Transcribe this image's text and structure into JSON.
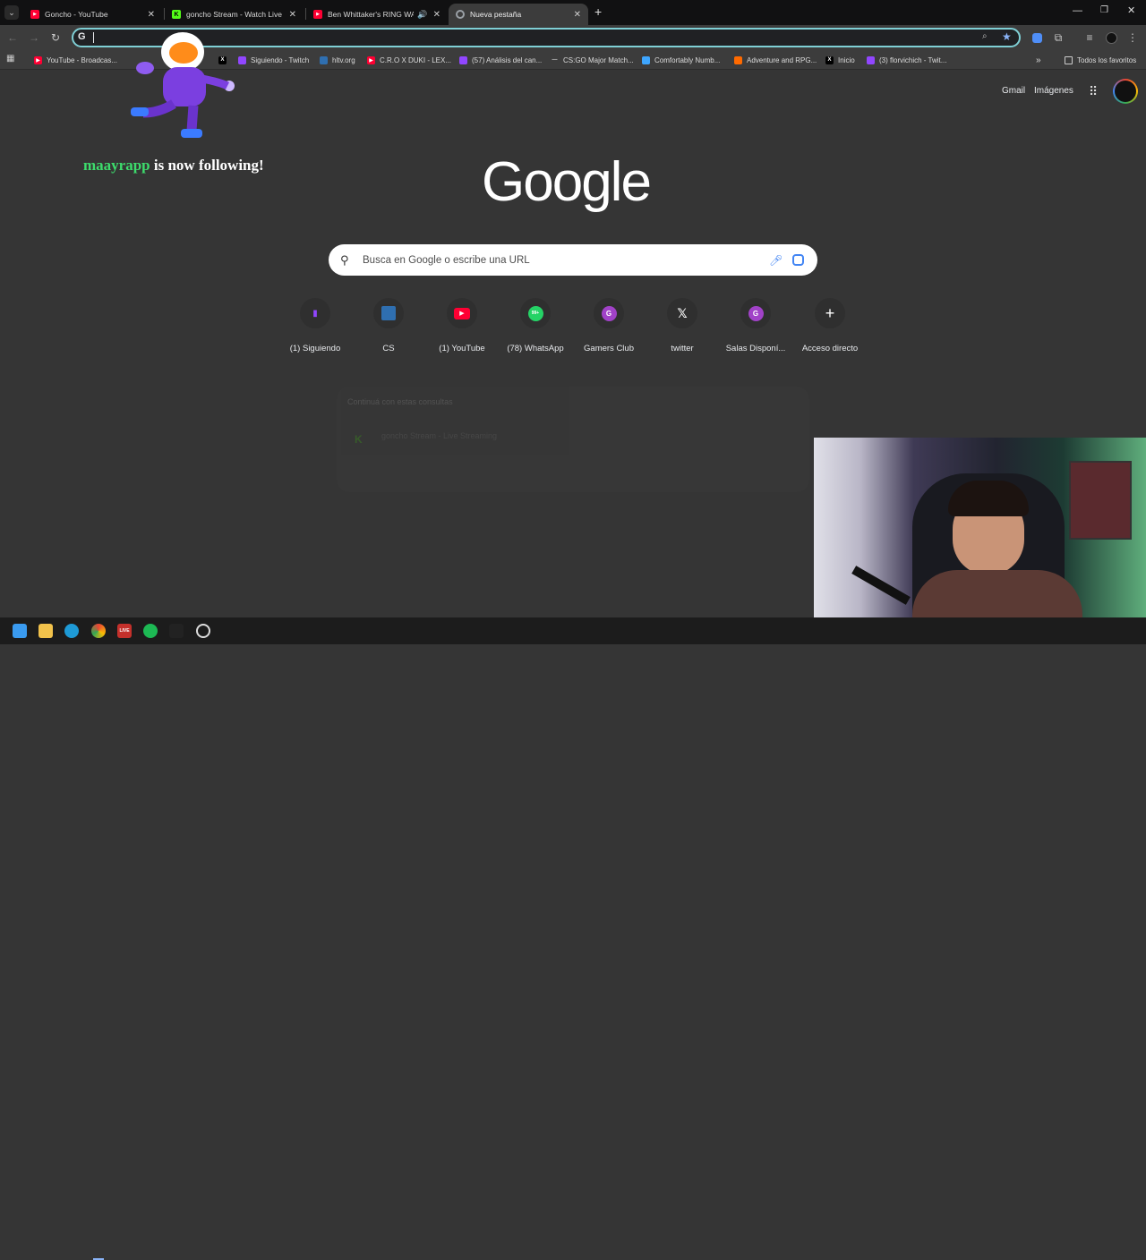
{
  "tabs": [
    {
      "title": "Goncho - YouTube",
      "favicon": "youtube-icon",
      "color": "#ff0033"
    },
    {
      "title": "goncho Stream - Watch Live on",
      "favicon": "kick-icon",
      "color": "#53fc18"
    },
    {
      "title": "Ben Whittaker's RING WALK",
      "favicon": "youtube-icon",
      "color": "#ff0033"
    },
    {
      "title": "Nueva pestaña",
      "favicon": "chrome-icon",
      "color": "#9aa0a6",
      "active": true
    }
  ],
  "omnibox": {
    "value": "",
    "placeholder": ""
  },
  "bookmarks": [
    {
      "label": "YouTube - Broadcas...",
      "icon": "youtube-icon",
      "color": "#ff0033"
    },
    {
      "label": "Siguiendo - Twitch",
      "icon": "twitch-icon",
      "color": "#9146ff"
    },
    {
      "label": "hltv.org",
      "icon": "hltv-icon",
      "color": "#2f6fb0"
    },
    {
      "label": "C.R.O X DUKI - LEX...",
      "icon": "youtube-icon",
      "color": "#ff0033"
    },
    {
      "label": "(57) Análisis del can...",
      "icon": "twitch-icon",
      "color": "#9146ff"
    },
    {
      "label": "CS:GO Major Match...",
      "icon": "hltv-icon",
      "color": "#cccccc"
    },
    {
      "label": "Comfortably Numb...",
      "icon": "doc-icon",
      "color": "#3ea6ff"
    },
    {
      "label": "Adventure and RPG...",
      "icon": "fire-icon",
      "color": "#ff6a00"
    },
    {
      "label": "Inicio",
      "icon": "x-icon",
      "color": "#000000"
    },
    {
      "label": "(3) florvichich - Twit...",
      "icon": "twitch-icon",
      "color": "#9146ff"
    }
  ],
  "bookmarks_folder": "Todos los favoritos",
  "header_links": {
    "gmail": "Gmail",
    "images": "Imágenes"
  },
  "logo_text": "Google",
  "search": {
    "placeholder": "Busca en Google o escribe una URL"
  },
  "shortcuts": [
    {
      "label": "(1) Siguiendo",
      "icon": "twitch-icon",
      "color": "#9146ff",
      "glyph": "▮"
    },
    {
      "label": "CS",
      "icon": "hltv-icon",
      "color": "#2f6fb0",
      "glyph": "⟋"
    },
    {
      "label": "(1) YouTube",
      "icon": "youtube-icon",
      "color": "#ff0033",
      "glyph": "▶"
    },
    {
      "label": "(78) WhatsApp",
      "icon": "whatsapp-icon",
      "color": "#25d366",
      "glyph": "99+"
    },
    {
      "label": "Gamers Club",
      "icon": "letter-g-icon",
      "color": "#a142c8",
      "glyph": "G"
    },
    {
      "label": "twitter",
      "icon": "x-icon",
      "color": "#000000",
      "glyph": "𝕏"
    },
    {
      "label": "Salas Disponí...",
      "icon": "letter-g-icon",
      "color": "#a142c8",
      "glyph": "G"
    },
    {
      "label": "Acceso directo",
      "icon": "plus-icon",
      "color": "#3a3a3a",
      "glyph": "+"
    }
  ],
  "overlay": {
    "username": "maayrapp",
    "message": "is now following!"
  },
  "ghost_card": {
    "heading": "Continuá con estas consultas",
    "item": "goncho Stream - Live Streaming"
  }
}
